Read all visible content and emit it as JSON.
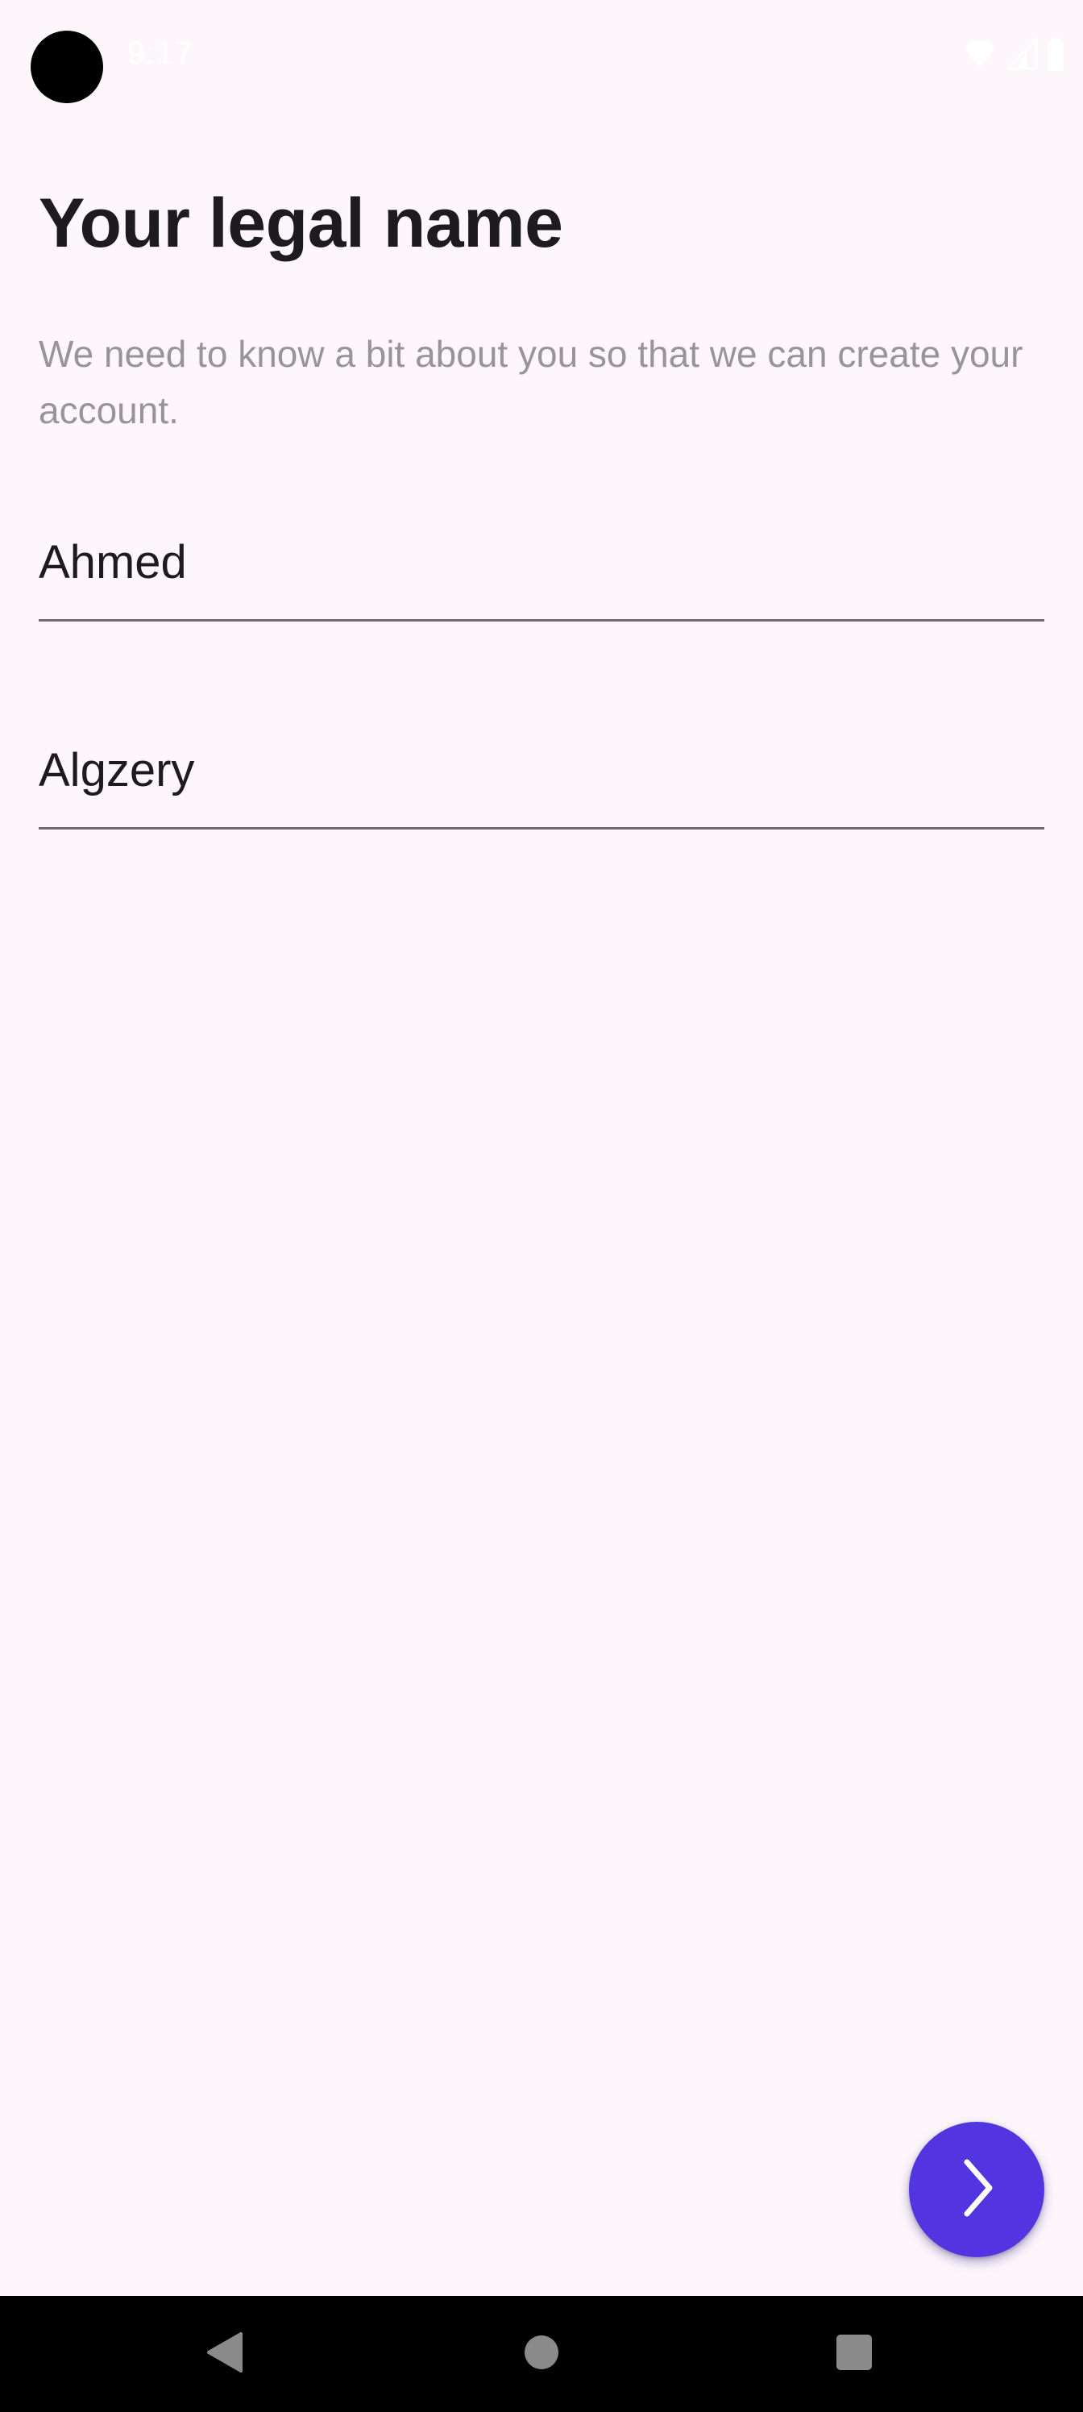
{
  "status_bar": {
    "time": "9:17",
    "icons": [
      "wifi-icon",
      "signal-icon",
      "battery-icon"
    ]
  },
  "page": {
    "title": "Your legal name",
    "subtitle": "We need to know a bit about you so that we can create your account."
  },
  "form": {
    "first_name": {
      "value": "Ahmed"
    },
    "last_name": {
      "value": "Algzery"
    }
  },
  "fab": {
    "icon": "chevron-right-icon",
    "color": "#5234e0"
  },
  "nav_bar": {
    "icons": [
      "back-icon",
      "home-icon",
      "recents-icon"
    ]
  },
  "colors": {
    "background": "#fdf7fc",
    "title": "#1d1b20",
    "subtitle": "#99939c",
    "field_underline": "#6f6a72",
    "accent": "#5234e0"
  }
}
